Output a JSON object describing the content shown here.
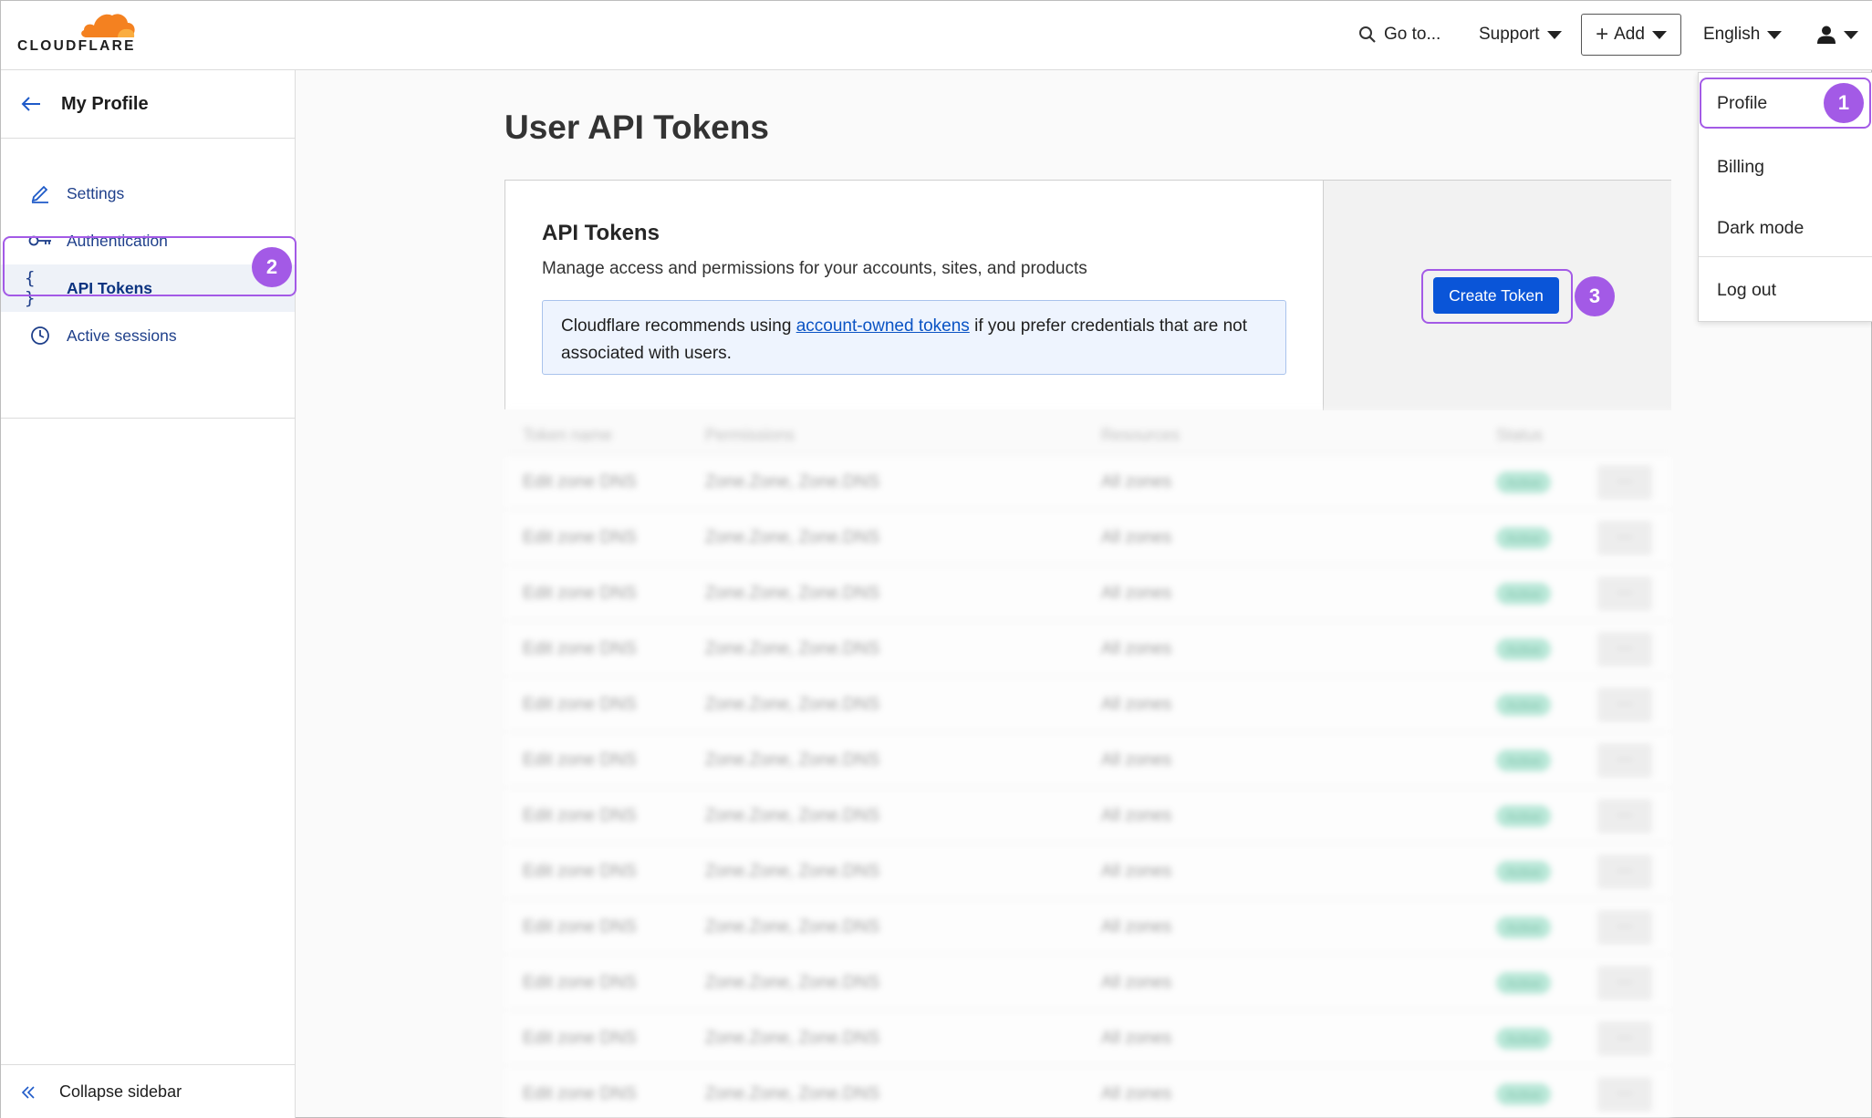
{
  "header": {
    "brand": "CLOUDFLARE",
    "goto": "Go to...",
    "support": "Support",
    "add": "Add",
    "language": "English"
  },
  "sidebar": {
    "back_title": "My Profile",
    "items": [
      {
        "label": "Settings",
        "icon": "pencil-icon"
      },
      {
        "label": "Authentication",
        "icon": "key-icon"
      },
      {
        "label": "API Tokens",
        "icon": "braces-icon",
        "active": true
      },
      {
        "label": "Active sessions",
        "icon": "clock-icon"
      }
    ],
    "collapse": "Collapse sidebar"
  },
  "main": {
    "title": "User API Tokens",
    "card": {
      "title": "API Tokens",
      "description": "Manage access and permissions for your accounts, sites, and products",
      "notice_before": "Cloudflare recommends using ",
      "notice_link": "account-owned tokens",
      "notice_after": " if you prefer credentials that are not associated with users.",
      "create_button": "Create Token"
    },
    "table": {
      "headers": [
        "Token name",
        "Permissions",
        "Resources",
        "Status"
      ],
      "rows": [
        {
          "name": "Edit zone DNS",
          "permissions": "Zone.Zone, Zone.DNS",
          "resources": "All zones",
          "status": "Active"
        },
        {
          "name": "Edit zone DNS",
          "permissions": "Zone.Zone, Zone.DNS",
          "resources": "All zones",
          "status": "Active"
        },
        {
          "name": "Edit zone DNS",
          "permissions": "Zone.Zone, Zone.DNS",
          "resources": "All zones",
          "status": "Active"
        },
        {
          "name": "Edit zone DNS",
          "permissions": "Zone.Zone, Zone.DNS",
          "resources": "All zones",
          "status": "Active"
        },
        {
          "name": "Edit zone DNS",
          "permissions": "Zone.Zone, Zone.DNS",
          "resources": "All zones",
          "status": "Active"
        },
        {
          "name": "Edit zone DNS",
          "permissions": "Zone.Zone, Zone.DNS",
          "resources": "All zones",
          "status": "Active"
        },
        {
          "name": "Edit zone DNS",
          "permissions": "Zone.Zone, Zone.DNS",
          "resources": "All zones",
          "status": "Active"
        },
        {
          "name": "Edit zone DNS",
          "permissions": "Zone.Zone, Zone.DNS",
          "resources": "All zones",
          "status": "Active"
        },
        {
          "name": "Edit zone DNS",
          "permissions": "Zone.Zone, Zone.DNS",
          "resources": "All zones",
          "status": "Active"
        },
        {
          "name": "Edit zone DNS",
          "permissions": "Zone.Zone, Zone.DNS",
          "resources": "All zones",
          "status": "Active"
        },
        {
          "name": "Edit zone DNS",
          "permissions": "Zone.Zone, Zone.DNS",
          "resources": "All zones",
          "status": "Active"
        },
        {
          "name": "Edit zone DNS",
          "permissions": "Zone.Zone, Zone.DNS",
          "resources": "All zones",
          "status": "Active"
        }
      ],
      "actions_label": "···"
    }
  },
  "user_menu": {
    "items": [
      "Profile",
      "Billing",
      "Dark mode",
      "Log out"
    ]
  },
  "annotations": {
    "step1": "1",
    "step2": "2",
    "step3": "3",
    "highlight_color": "#a35ae6"
  },
  "colors": {
    "brand_orange": "#f48120",
    "primary_blue": "#0a55d8",
    "link_blue": "#1e3f8a"
  }
}
